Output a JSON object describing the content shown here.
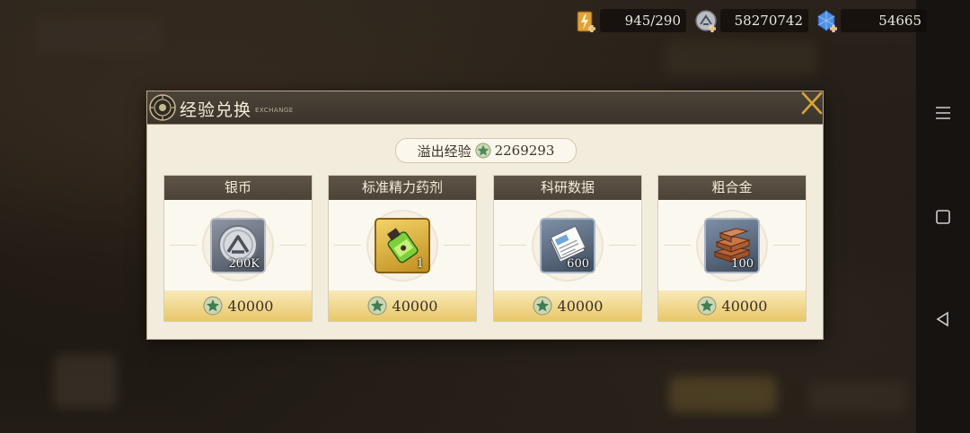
{
  "resources": {
    "stamina": "945/290",
    "coins": "58270742",
    "gems": "54665"
  },
  "panel": {
    "title": "经验兑换",
    "subtitle": "EXCHANGE",
    "overflow_label": "溢出经验",
    "overflow_value": "2269293"
  },
  "items": [
    {
      "name": "银币",
      "qty": "200K",
      "cost": "40000",
      "icon": "silver-coin-icon"
    },
    {
      "name": "标准精力药剂",
      "qty": "1",
      "cost": "40000",
      "icon": "energy-potion-icon"
    },
    {
      "name": "科研数据",
      "qty": "600",
      "cost": "40000",
      "icon": "research-data-icon"
    },
    {
      "name": "粗合金",
      "qty": "100",
      "cost": "40000",
      "icon": "alloy-ingot-icon"
    }
  ],
  "colors": {
    "panel_bg": "#f2ecdd",
    "header_bg": "#4b4338",
    "cost_gold": "#e9c86a",
    "accent_gold": "#d6a52a"
  }
}
